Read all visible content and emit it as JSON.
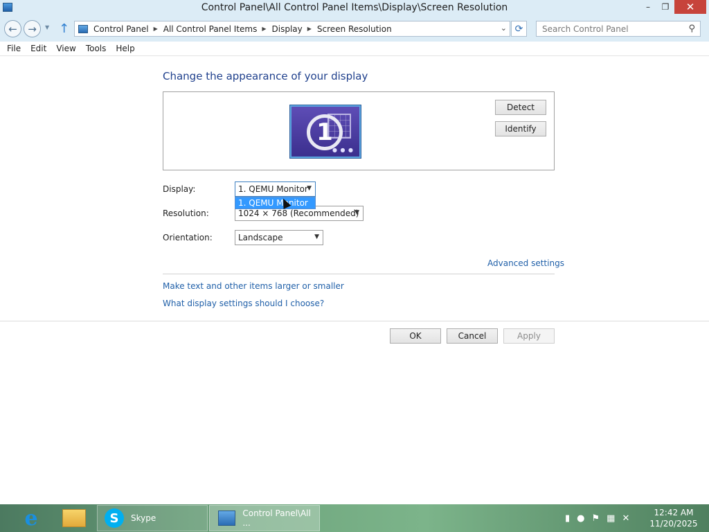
{
  "window": {
    "title": "Control Panel\\All Control Panel Items\\Display\\Screen Resolution",
    "minimize": "–",
    "maximize": "❐",
    "close": "✕"
  },
  "nav": {
    "back": "←",
    "forward": "→",
    "recent": "▼",
    "up": "↑",
    "breadcrumbs": [
      "Control Panel",
      "All Control Panel Items",
      "Display",
      "Screen Resolution"
    ],
    "dropdown": "⌄",
    "refresh": "⟳",
    "search_placeholder": "Search Control Panel",
    "search_icon": "⚲"
  },
  "menu": [
    "File",
    "Edit",
    "View",
    "Tools",
    "Help"
  ],
  "content": {
    "heading": "Change the appearance of your display",
    "monitor_number": "1",
    "detect": "Detect",
    "identify": "Identify",
    "display_label": "Display:",
    "display_value": "1. QEMU Monitor",
    "display_dropdown_option": "1. QEMU Monitor",
    "resolution_label": "Resolution:",
    "resolution_value": "1024 × 768 (Recommended)",
    "orientation_label": "Orientation:",
    "orientation_value": "Landscape",
    "advanced_settings": "Advanced settings",
    "link_larger": "Make text and other items larger or smaller",
    "link_what": "What display settings should I choose?",
    "ok": "OK",
    "cancel": "Cancel",
    "apply": "Apply"
  },
  "taskbar": {
    "skype_label": "Skype",
    "control_panel_label": "Control Panel\\All ...",
    "time": "12:42 AM",
    "date": "11/20/2025"
  },
  "colors": {
    "accent_link": "#1f5fa8",
    "heading": "#1e3f8c",
    "selection": "#3399ff",
    "close_button": "#c7443b"
  }
}
